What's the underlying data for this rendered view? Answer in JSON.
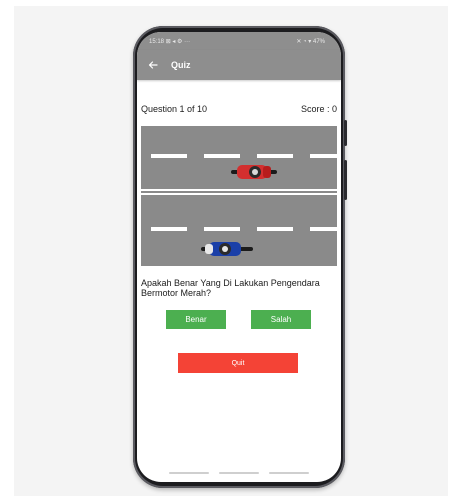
{
  "status_bar": {
    "time": "15:18",
    "left_icons": "⊠ ◂ ⚙ ···",
    "right_text": "✕ ◔ ▾ 47%"
  },
  "app_bar": {
    "title": "Quiz",
    "back_icon": "arrow-left-icon"
  },
  "quiz": {
    "question_counter": "Question 1 of 10",
    "score": "Score : 0",
    "question_text": "Apakah Benar Yang Di Lakukan Pengendara Bermotor Merah?",
    "answer_true_label": "Benar",
    "answer_false_label": "Salah",
    "quit_label": "Quit"
  },
  "colors": {
    "app_bar": "#8e8e8e",
    "answer_button": "#4caf50",
    "quit_button": "#f44336",
    "road": "#8a8a8a",
    "red_motorcycle": "#d32f2f",
    "blue_motorcycle": "#1a3fa8"
  }
}
